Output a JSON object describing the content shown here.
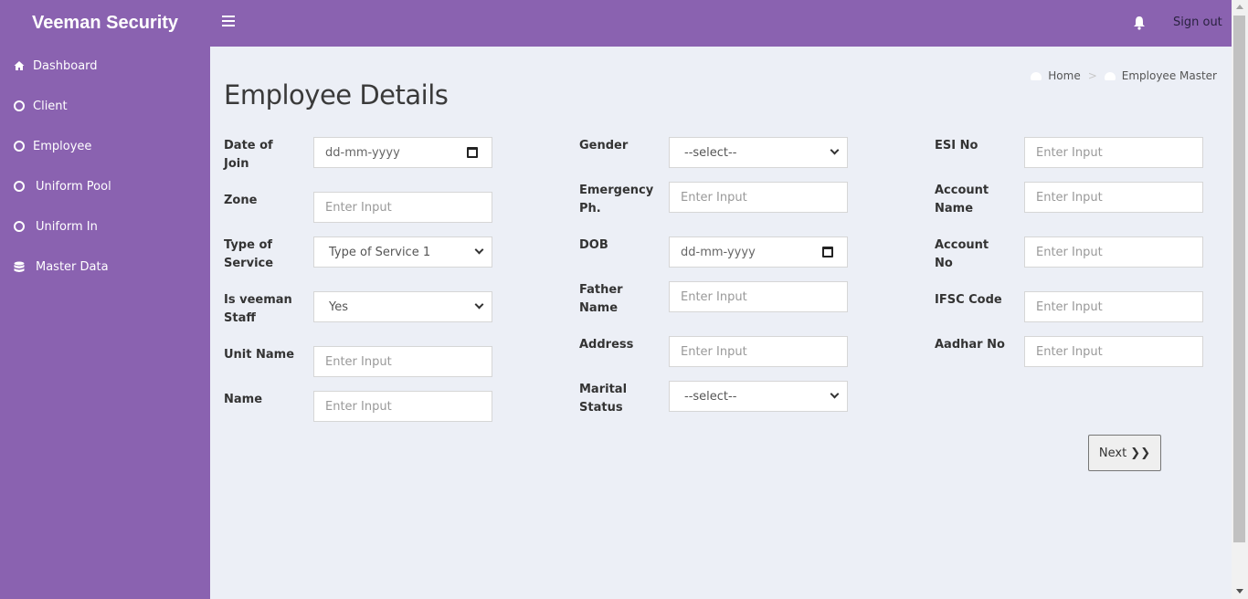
{
  "header": {
    "brand": "Veeman Security",
    "menu_icon": "hamburger-icon",
    "notification_icon": "bell-icon",
    "signout_label": "Sign out"
  },
  "sidebar": {
    "items": [
      {
        "label": "Dashboard",
        "icon": "home-icon"
      },
      {
        "label": "Client",
        "icon": "circle-icon"
      },
      {
        "label": "Employee",
        "icon": "circle-icon"
      },
      {
        "label": "Uniform Pool",
        "icon": "circle-icon"
      },
      {
        "label": "Uniform In",
        "icon": "circle-icon"
      },
      {
        "label": "Master Data",
        "icon": "database-icon"
      }
    ]
  },
  "breadcrumb": {
    "home": "Home",
    "separator": ">",
    "current": "Employee Master"
  },
  "page": {
    "title": "Employee Details"
  },
  "form": {
    "col1": [
      {
        "label": "Date of Join",
        "type": "date",
        "value": "dd-mm-yyyy"
      },
      {
        "label": "Zone",
        "type": "text",
        "placeholder": "Enter Input"
      },
      {
        "label": "Type of Service",
        "type": "select",
        "value": "Type of Service 1"
      },
      {
        "label": "Is veeman Staff",
        "type": "select",
        "value": "Yes"
      },
      {
        "label": "Unit Name",
        "type": "text",
        "placeholder": "Enter Input"
      },
      {
        "label": "Name",
        "type": "text",
        "placeholder": "Enter Input"
      }
    ],
    "col2": [
      {
        "label": "Gender",
        "type": "select",
        "value": "--select--"
      },
      {
        "label": "Emergency Ph.",
        "type": "text",
        "placeholder": "Enter Input"
      },
      {
        "label": "DOB",
        "type": "date",
        "value": "dd-mm-yyyy"
      },
      {
        "label": "Father Name",
        "type": "text",
        "placeholder": "Enter Input"
      },
      {
        "label": "Address",
        "type": "text",
        "placeholder": "Enter Input"
      },
      {
        "label": "Marital Status",
        "type": "select",
        "value": "--select--"
      }
    ],
    "col3": [
      {
        "label": "ESI No",
        "type": "text",
        "placeholder": "Enter Input"
      },
      {
        "label": "Account Name",
        "type": "text",
        "placeholder": "Enter Input"
      },
      {
        "label": "Account No",
        "type": "text",
        "placeholder": "Enter Input"
      },
      {
        "label": "IFSC Code",
        "type": "text",
        "placeholder": "Enter Input"
      },
      {
        "label": "Aadhar No",
        "type": "text",
        "placeholder": "Enter Input"
      }
    ],
    "next_label": "Next ❯❯"
  }
}
